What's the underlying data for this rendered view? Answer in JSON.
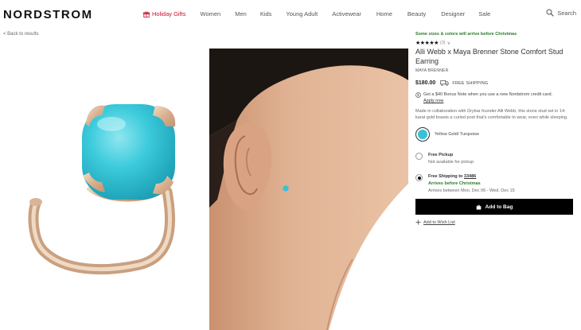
{
  "header": {
    "logo": "NORDSTROM",
    "nav": [
      {
        "label": "Holiday Gifts",
        "name": "holiday-gifts"
      },
      {
        "label": "Women",
        "name": "women"
      },
      {
        "label": "Men",
        "name": "men"
      },
      {
        "label": "Kids",
        "name": "kids"
      },
      {
        "label": "Young Adult",
        "name": "young-adult"
      },
      {
        "label": "Activewear",
        "name": "activewear"
      },
      {
        "label": "Home",
        "name": "home"
      },
      {
        "label": "Beauty",
        "name": "beauty"
      },
      {
        "label": "Designer",
        "name": "designer"
      },
      {
        "label": "Sale",
        "name": "sale"
      }
    ],
    "search_label": "Search"
  },
  "back_link": "< Back to results",
  "product": {
    "promo": "Some sizes & colors will arrive before Christmas",
    "stars": "★★★★★",
    "rating_count": "(3)",
    "rating_chevron": "∨",
    "title": "Alli Webb x Maya Brenner Stone Comfort Stud Earring",
    "brand": "MAYA BRENNER",
    "price": "$180.00",
    "shipping": "FREE SHIPPING",
    "bonus_text": "Get a $40 Bonus Note when you use a new Nordstrom credit card.",
    "apply_label": "Apply now",
    "description": "Made in collaboration with Drybar founder Alli Webb, this stone stud set in 14-karat gold boasts a curled post that's comfortable to wear, even while sleeping.",
    "color": {
      "label": "Yellow Gold/ Turquoise",
      "hex": "#36c2d4"
    },
    "pickup": {
      "title": "Free Pickup",
      "sub": "Not available for pickup",
      "selected": false
    },
    "delivery": {
      "title_prefix": "Free Shipping to",
      "zip": "33486",
      "arrive": "Arrives before Christmas",
      "dates": "Arrives between Mon, Dec 06 - Wed, Dec 15",
      "selected": true
    },
    "add_to_bag": "Add to Bag",
    "wish_list": "Add to Wish List"
  },
  "colors": {
    "accent_red": "#c8102e",
    "promo_green": "#2b7a2b",
    "button_black": "#000000"
  }
}
